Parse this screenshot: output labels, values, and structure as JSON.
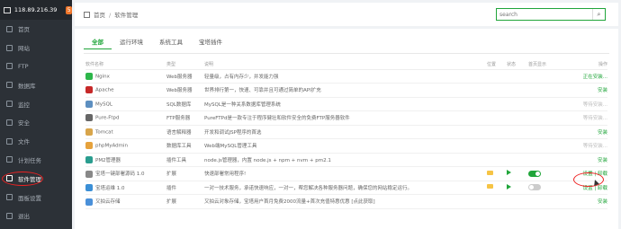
{
  "server": {
    "ip": "118.89.216.39",
    "badge": "5"
  },
  "sidebar": {
    "items": [
      {
        "label": "首页"
      },
      {
        "label": "网站"
      },
      {
        "label": "FTP"
      },
      {
        "label": "数据库"
      },
      {
        "label": "监控"
      },
      {
        "label": "安全"
      },
      {
        "label": "文件"
      },
      {
        "label": "计划任务"
      },
      {
        "label": "软件管理"
      },
      {
        "label": "面板设置"
      },
      {
        "label": "退出"
      }
    ],
    "active_index": 8
  },
  "breadcrumb": {
    "home": "首页",
    "current": "软件管理"
  },
  "search": {
    "placeholder": "search"
  },
  "tabs": [
    {
      "label": "全部"
    },
    {
      "label": "运行环境"
    },
    {
      "label": "系统工具"
    },
    {
      "label": "宝塔插件"
    }
  ],
  "table": {
    "headers": {
      "name": "软件名称",
      "type": "类型",
      "desc": "说明",
      "pos": "位置",
      "status": "状态",
      "home": "首页显示",
      "op": "操作"
    },
    "rows": [
      {
        "name": "Nginx",
        "type": "Web服务器",
        "desc": "轻量级，占有内存少，并发能力强",
        "op": "正在安装...",
        "op_style": "green",
        "icon": "#2db64a"
      },
      {
        "name": "Apache",
        "type": "Web服务器",
        "desc": "世界排行第一，快速、可靠并且可通过简单的API扩充",
        "op": "安装",
        "op_style": "green",
        "icon": "#c62828"
      },
      {
        "name": "MySQL",
        "type": "SQL数据库",
        "desc": "MySQL是一种关系数据库管理系统",
        "op": "等待安装...",
        "op_style": "gray",
        "icon": "#5d8fc0"
      },
      {
        "name": "Pure-Ftpd",
        "type": "FTP服务器",
        "desc": "PureFTPd是一款专注于程序健壮和软件安全的免费FTP服务器软件",
        "op": "等待安装...",
        "op_style": "gray",
        "icon": "#666666"
      },
      {
        "name": "Tomcat",
        "type": "语言解释器",
        "desc": "开发和调试JSP程序的首选",
        "op": "安装",
        "op_style": "green",
        "icon": "#d8a54a"
      },
      {
        "name": "phpMyAdmin",
        "type": "数据库工具",
        "desc": "Web端MySQL管理工具",
        "op": "等待安装...",
        "op_style": "gray",
        "icon": "#e6a23c"
      },
      {
        "name": "PM2管理器",
        "type": "插件工具",
        "desc": "node.js管理器，内置 node.js + npm + nvm + pm2.1",
        "op": "安装",
        "op_style": "green",
        "icon": "#2a9d8f"
      },
      {
        "name": "宝塔一键部署源码 1.0",
        "type": "扩展",
        "desc": "快速部署常用程序!",
        "op": "设置 | 卸载",
        "op_style": "green",
        "icon": "#888888",
        "installed": true,
        "toggle_on": true
      },
      {
        "name": "宝塔运维 1.0",
        "type": "插件",
        "desc": "一对一技术服务，承诺快速响应，一对一，帮您解决各种服务器问题，确保您的网站稳定运行。",
        "op": "设置 | 卸载",
        "op_style": "green",
        "icon": "#3b8fd6",
        "installed": true,
        "toggle_on": false
      },
      {
        "name": "又拍云存储",
        "type": "扩展",
        "desc": "又拍云对象存储，宝塔用户首月免费2000流量+首次充值特惠优惠 [点此获取]",
        "op": "安装",
        "op_style": "green",
        "icon": "#4a90d9"
      }
    ]
  }
}
